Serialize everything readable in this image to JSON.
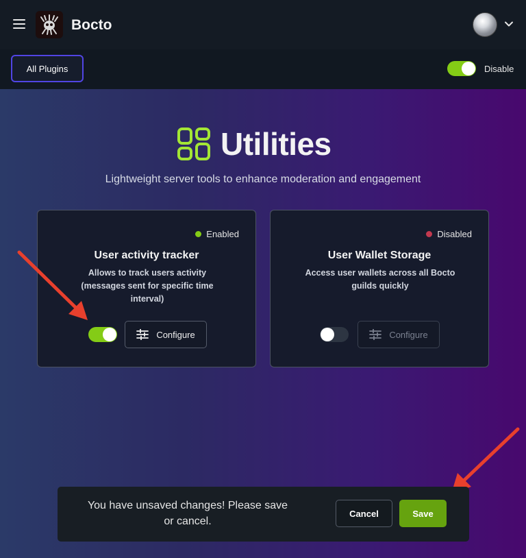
{
  "header": {
    "app_name": "Bocto",
    "menu_icon": "hamburger-icon",
    "avatar_icon": "user-avatar",
    "chevron_icon": "chevron-down-icon"
  },
  "toolbar": {
    "all_plugins_label": "All Plugins",
    "global_toggle_label": "Disable",
    "global_toggle_on": true
  },
  "hero": {
    "title": "Utilities",
    "subtitle": "Lightweight server tools to enhance moderation and engagement",
    "icon": "grid-icon",
    "accent_color": "#a3e635"
  },
  "plugins": [
    {
      "status": "Enabled",
      "status_color": "#84cc16",
      "title": "User activity tracker",
      "description": "Allows to track users activity (messages sent for specific time interval)",
      "toggle_on": true,
      "configure_label": "Configure",
      "configure_enabled": true
    },
    {
      "status": "Disabled",
      "status_color": "#c2394f",
      "title": "User Wallet Storage",
      "description": "Access user wallets across all Bocto guilds quickly",
      "toggle_on": false,
      "configure_label": "Configure",
      "configure_enabled": false
    }
  ],
  "unsaved_bar": {
    "message": "You have unsaved changes! Please save or cancel.",
    "cancel_label": "Cancel",
    "save_label": "Save",
    "save_color": "#66a30f"
  },
  "annotations": {
    "arrow_color": "#e8402d"
  }
}
